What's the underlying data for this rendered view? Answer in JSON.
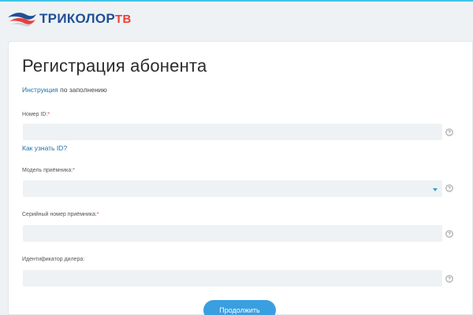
{
  "brand": {
    "name": "ТРИКОЛОР",
    "suffix": "ТВ",
    "colors": {
      "blue": "#1f4f97",
      "red": "#e8403a",
      "accent": "#3a9fe0"
    }
  },
  "form": {
    "title": "Регистрация абонента",
    "instruction_link": "Инструкция",
    "instruction_rest": " по заполнению",
    "fields": [
      {
        "label": "Номер ID:",
        "required": "*",
        "value": "",
        "help_icon": "question-circle-icon"
      },
      {
        "label": "Модель приёмника:",
        "required": "*",
        "value": "",
        "help_icon": "question-circle-icon",
        "type": "select"
      },
      {
        "label": "Серийный номер приёмника:",
        "required": "*",
        "value": "",
        "help_icon": "question-circle-icon"
      },
      {
        "label": "Идентификатор дилера:",
        "required": "",
        "value": "",
        "help_icon": "question-circle-icon"
      }
    ],
    "how_to_find_id": "Как узнать ID?",
    "submit_label": "Продолжить"
  }
}
